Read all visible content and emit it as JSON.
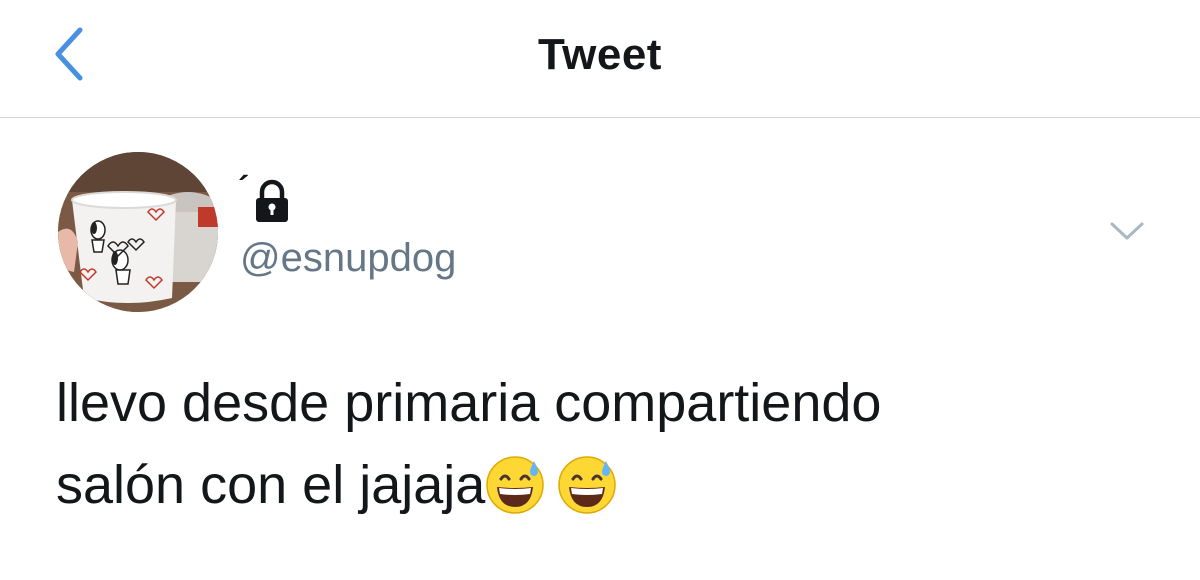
{
  "header": {
    "title": "Tweet",
    "back_icon": "chevron-left-icon"
  },
  "author": {
    "display_name": "´",
    "handle": "@esnupdog",
    "protected": true,
    "avatar": "snoopy-mug-avatar"
  },
  "tweet": {
    "line1": "llevo desde primaria compartiendo",
    "line2": "salón con el jajaja",
    "emojis": [
      "grinning-face-with-sweat-emoji",
      "grinning-face-with-sweat-emoji"
    ]
  },
  "menu_icon": "chevron-down-icon",
  "colors": {
    "accent": "#4a90e2",
    "text": "#14171a",
    "secondary": "#657786",
    "divider": "#d3d6da"
  }
}
